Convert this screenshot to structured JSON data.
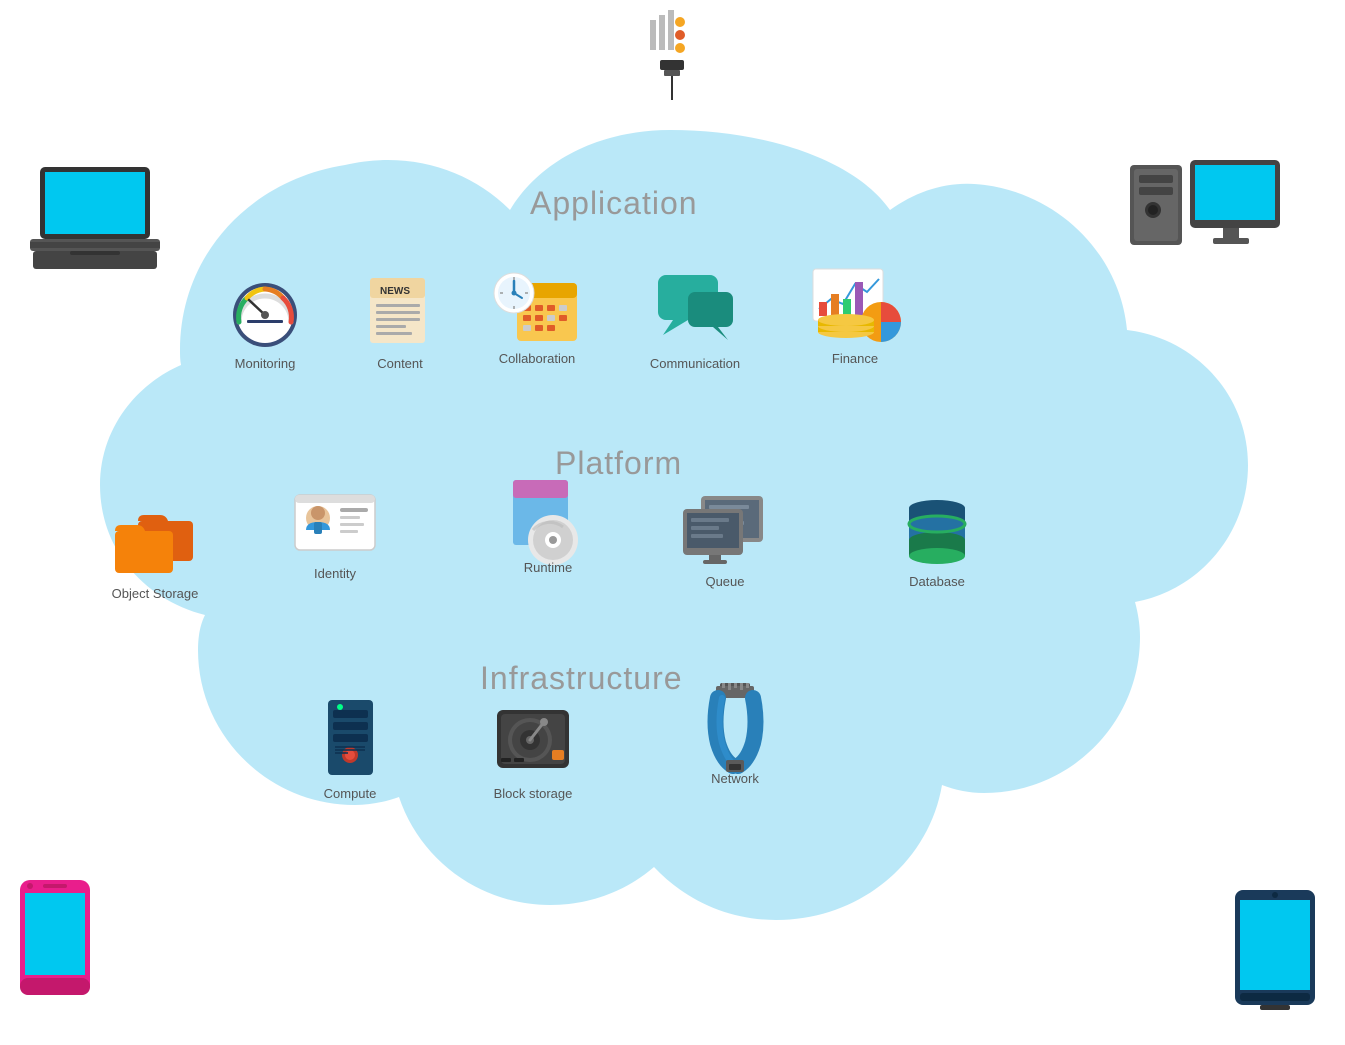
{
  "sections": {
    "application_label": "Application",
    "platform_label": "Platform",
    "infrastructure_label": "Infrastructure"
  },
  "icons": {
    "monitoring": "Monitoring",
    "content": "Content",
    "collaboration": "Collaboration",
    "communication": "Communication",
    "finance": "Finance",
    "identity": "Identity",
    "runtime": "Runtime",
    "queue": "Queue",
    "database": "Database",
    "object_storage": "Object Storage",
    "compute": "Compute",
    "block_storage": "Block storage",
    "network": "Network"
  }
}
